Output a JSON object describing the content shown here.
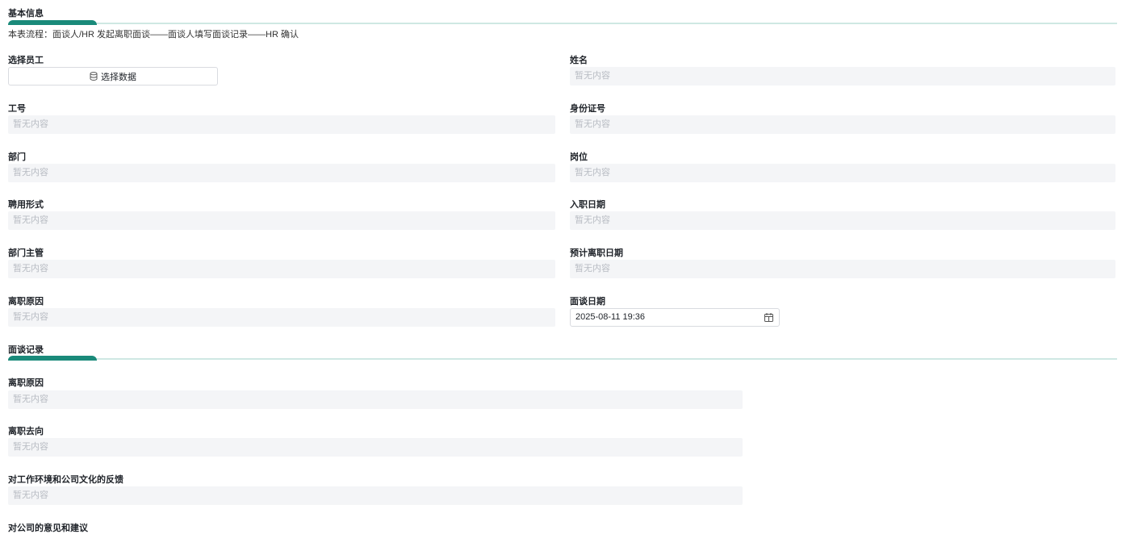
{
  "basic": {
    "title": "基本信息",
    "description": "本表流程：面谈人/HR 发起离职面谈——面谈人填写面谈记录——HR 确认",
    "select_employee_label": "选择员工",
    "select_data_button": "选择数据",
    "fields": [
      {
        "label": "姓名",
        "value": "暂无内容"
      },
      {
        "label": "工号",
        "value": "暂无内容"
      },
      {
        "label": "身份证号",
        "value": "暂无内容"
      },
      {
        "label": "部门",
        "value": "暂无内容"
      },
      {
        "label": "岗位",
        "value": "暂无内容"
      },
      {
        "label": "聘用形式",
        "value": "暂无内容"
      },
      {
        "label": "入职日期",
        "value": "暂无内容"
      },
      {
        "label": "部门主管",
        "value": "暂无内容"
      },
      {
        "label": "预计离职日期",
        "value": "暂无内容"
      },
      {
        "label": "离职原因",
        "value": "暂无内容"
      }
    ],
    "interview_date_label": "面谈日期",
    "interview_date_value": "2025-08-11 19:36"
  },
  "record": {
    "title": "面谈记录",
    "fields": [
      {
        "label": "离职原因",
        "value": "暂无内容"
      },
      {
        "label": "离职去向",
        "value": "暂无内容"
      },
      {
        "label": "对工作环境和公司文化的反馈",
        "value": "暂无内容"
      },
      {
        "label": "对公司的意见和建议"
      }
    ]
  },
  "icons": {
    "select_data": "database-icon",
    "date_picker": "calendar-icon"
  },
  "colors": {
    "accent": "#1a8a7a",
    "divider": "#cfe8e3",
    "field_bg": "#f4f5f7",
    "placeholder": "#b8bcc3"
  }
}
